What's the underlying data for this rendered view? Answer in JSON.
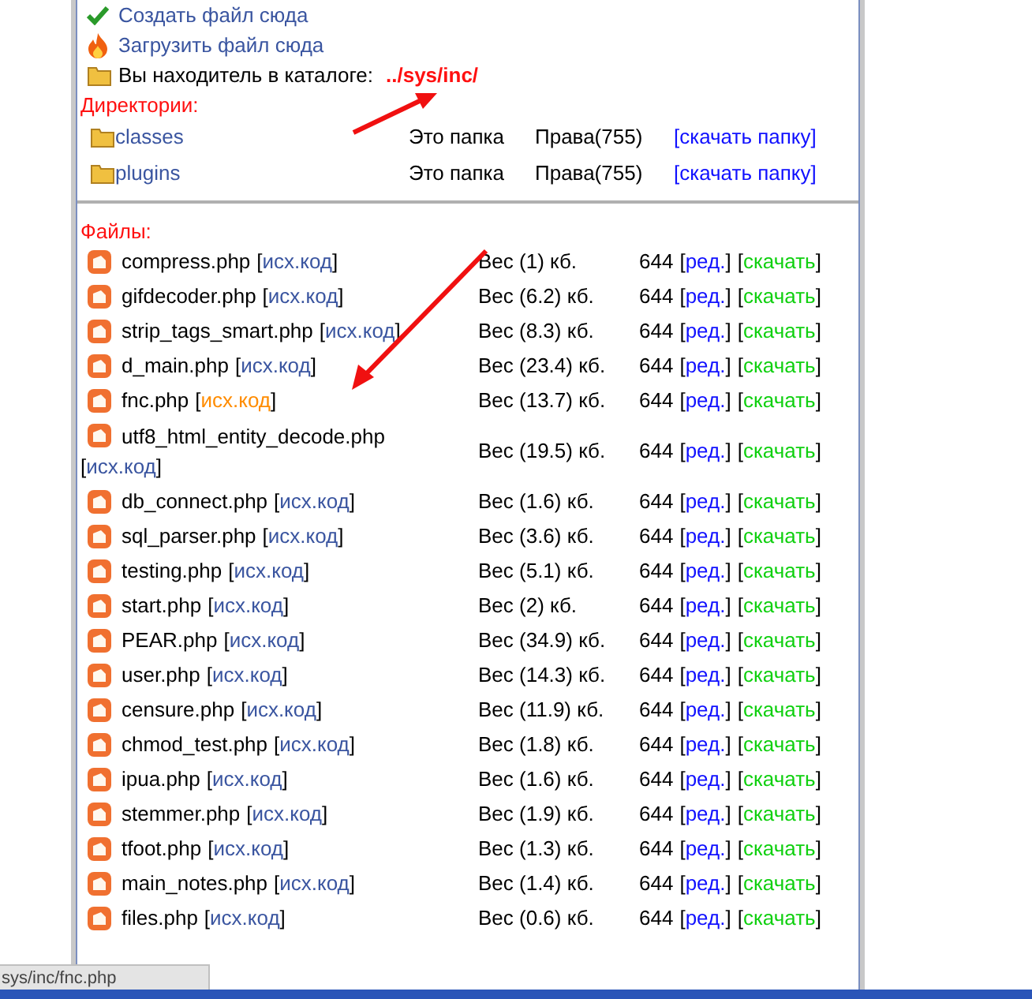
{
  "actions": [
    {
      "kind": "create",
      "label": "Создать файл сюда"
    },
    {
      "kind": "upload",
      "label": "Загрузить файл сюда"
    }
  ],
  "location": {
    "label": "Вы находитель в каталоге:",
    "path": "../sys/inc/"
  },
  "directories": {
    "title": "Директории:",
    "items": [
      {
        "name": "classes",
        "type": "Это папка",
        "rights": "Права(755)",
        "download": "[скачать папку]"
      },
      {
        "name": "plugins",
        "type": "Это папка",
        "rights": "Права(755)",
        "download": "[скачать папку]"
      }
    ]
  },
  "files": {
    "title": "Файлы:",
    "items": [
      {
        "name": "compress.php",
        "source": "[исх.код]",
        "hovered": false,
        "size": "Вес (1) кб.",
        "mode": "644",
        "edit": "[ред.]",
        "download": "[скачать]"
      },
      {
        "name": "gifdecoder.php",
        "source": "[исх.код]",
        "hovered": false,
        "size": "Вес (6.2) кб.",
        "mode": "644",
        "edit": "[ред.]",
        "download": "[скачать]"
      },
      {
        "name": "strip_tags_smart.php",
        "source": "[исх.код]",
        "hovered": false,
        "size": "Вес (8.3) кб.",
        "mode": "644",
        "edit": "[ред.]",
        "download": "[скачать]"
      },
      {
        "name": "d_main.php",
        "source": "[исх.код]",
        "hovered": false,
        "size": "Вес (23.4) кб.",
        "mode": "644",
        "edit": "[ред.]",
        "download": "[скачать]"
      },
      {
        "name": "fnc.php",
        "source": "[исх.код]",
        "hovered": true,
        "size": "Вес (13.7) кб.",
        "mode": "644",
        "edit": "[ред.]",
        "download": "[скачать]"
      },
      {
        "name": "utf8_html_entity_decode.php",
        "source": "[исх.код]",
        "hovered": false,
        "size": "Вес (19.5) кб.",
        "mode": "644",
        "edit": "[ред.]",
        "download": "[скачать]"
      },
      {
        "name": "db_connect.php",
        "source": "[исх.код]",
        "hovered": false,
        "size": "Вес (1.6) кб.",
        "mode": "644",
        "edit": "[ред.]",
        "download": "[скачать]"
      },
      {
        "name": "sql_parser.php",
        "source": "[исх.код]",
        "hovered": false,
        "size": "Вес (3.6) кб.",
        "mode": "644",
        "edit": "[ред.]",
        "download": "[скачать]"
      },
      {
        "name": "testing.php",
        "source": "[исх.код]",
        "hovered": false,
        "size": "Вес (5.1) кб.",
        "mode": "644",
        "edit": "[ред.]",
        "download": "[скачать]"
      },
      {
        "name": "start.php",
        "source": "[исх.код]",
        "hovered": false,
        "size": "Вес (2) кб.",
        "mode": "644",
        "edit": "[ред.]",
        "download": "[скачать]"
      },
      {
        "name": "PEAR.php",
        "source": "[исх.код]",
        "hovered": false,
        "size": "Вес (34.9) кб.",
        "mode": "644",
        "edit": "[ред.]",
        "download": "[скачать]"
      },
      {
        "name": "user.php",
        "source": "[исх.код]",
        "hovered": false,
        "size": "Вес (14.3) кб.",
        "mode": "644",
        "edit": "[ред.]",
        "download": "[скачать]"
      },
      {
        "name": "censure.php",
        "source": "[исх.код]",
        "hovered": false,
        "size": "Вес (11.9) кб.",
        "mode": "644",
        "edit": "[ред.]",
        "download": "[скачать]"
      },
      {
        "name": "chmod_test.php",
        "source": "[исх.код]",
        "hovered": false,
        "size": "Вес (1.8) кб.",
        "mode": "644",
        "edit": "[ред.]",
        "download": "[скачать]"
      },
      {
        "name": "ipua.php",
        "source": "[исх.код]",
        "hovered": false,
        "size": "Вес (1.6) кб.",
        "mode": "644",
        "edit": "[ред.]",
        "download": "[скачать]"
      },
      {
        "name": "stemmer.php",
        "source": "[исх.код]",
        "hovered": false,
        "size": "Вес (1.9) кб.",
        "mode": "644",
        "edit": "[ред.]",
        "download": "[скачать]"
      },
      {
        "name": "tfoot.php",
        "source": "[исх.код]",
        "hovered": false,
        "size": "Вес (1.3) кб.",
        "mode": "644",
        "edit": "[ред.]",
        "download": "[скачать]"
      },
      {
        "name": "main_notes.php",
        "source": "[исх.код]",
        "hovered": false,
        "size": "Вес (1.4) кб.",
        "mode": "644",
        "edit": "[ред.]",
        "download": "[скачать]"
      },
      {
        "name": "files.php",
        "source": "[исх.код]",
        "hovered": false,
        "size": "Вес (0.6) кб.",
        "mode": "644",
        "edit": "[ред.]",
        "download": "[скачать]"
      }
    ]
  },
  "status_bar": {
    "url": "sys/inc/fnc.php"
  }
}
